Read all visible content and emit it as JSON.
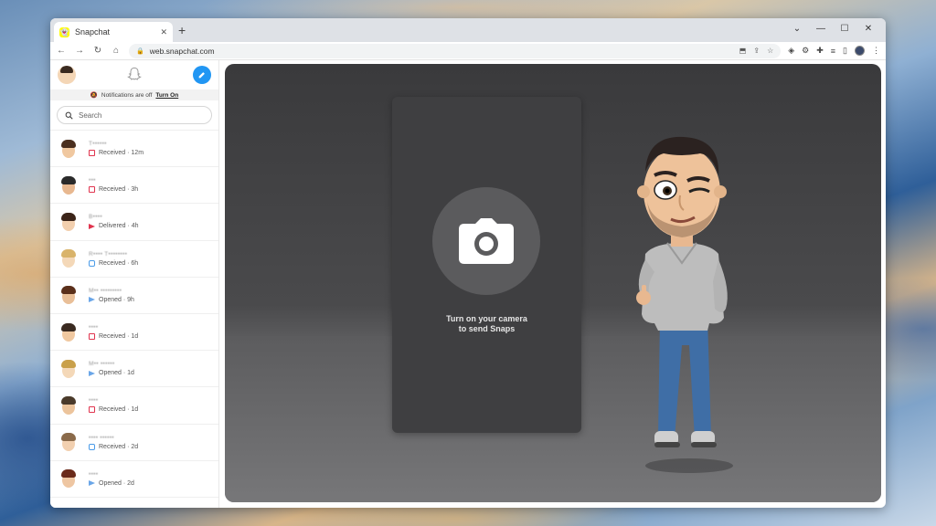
{
  "browser": {
    "tab_title": "Snapchat",
    "tab_favicon": "snapchat-ghost-icon",
    "new_tab": "+",
    "url": "web.snapchat.com",
    "window_controls": [
      "⌄",
      "—",
      "☐",
      "✕"
    ]
  },
  "sidebar": {
    "notification_text": "Notifications are off",
    "notification_link": "Turn On",
    "search_placeholder": "Search",
    "chats": [
      {
        "name": "T••••••",
        "status": "Received · 12m",
        "status_type": "received"
      },
      {
        "name": "•••",
        "status": "Received · 3h",
        "status_type": "received"
      },
      {
        "name": "B••••",
        "status": "Delivered · 4h",
        "status_type": "delivered"
      },
      {
        "name": "R•••• T••••••••",
        "status": "Received · 6h",
        "status_type": "received-chat"
      },
      {
        "name": "M•• •••••••••",
        "status": "Opened · 9h",
        "status_type": "opened"
      },
      {
        "name": "••••",
        "status": "Received · 1d",
        "status_type": "received"
      },
      {
        "name": "M•• ••••••",
        "status": "Opened · 1d",
        "status_type": "opened"
      },
      {
        "name": "••••",
        "status": "Received · 1d",
        "status_type": "received"
      },
      {
        "name": "•••• ••••••",
        "status": "Received · 2d",
        "status_type": "received-chat"
      },
      {
        "name": "••••",
        "status": "Opened · 2d",
        "status_type": "opened"
      }
    ]
  },
  "main": {
    "camera_prompt_line1": "Turn on your camera",
    "camera_prompt_line2": "to send Snaps",
    "camera_icon": "camera-icon"
  },
  "colors": {
    "accent_blue": "#2196f3",
    "snap_yellow": "#fffc00",
    "received_red": "#e0344e",
    "opened_blue": "#6aa6e8"
  }
}
